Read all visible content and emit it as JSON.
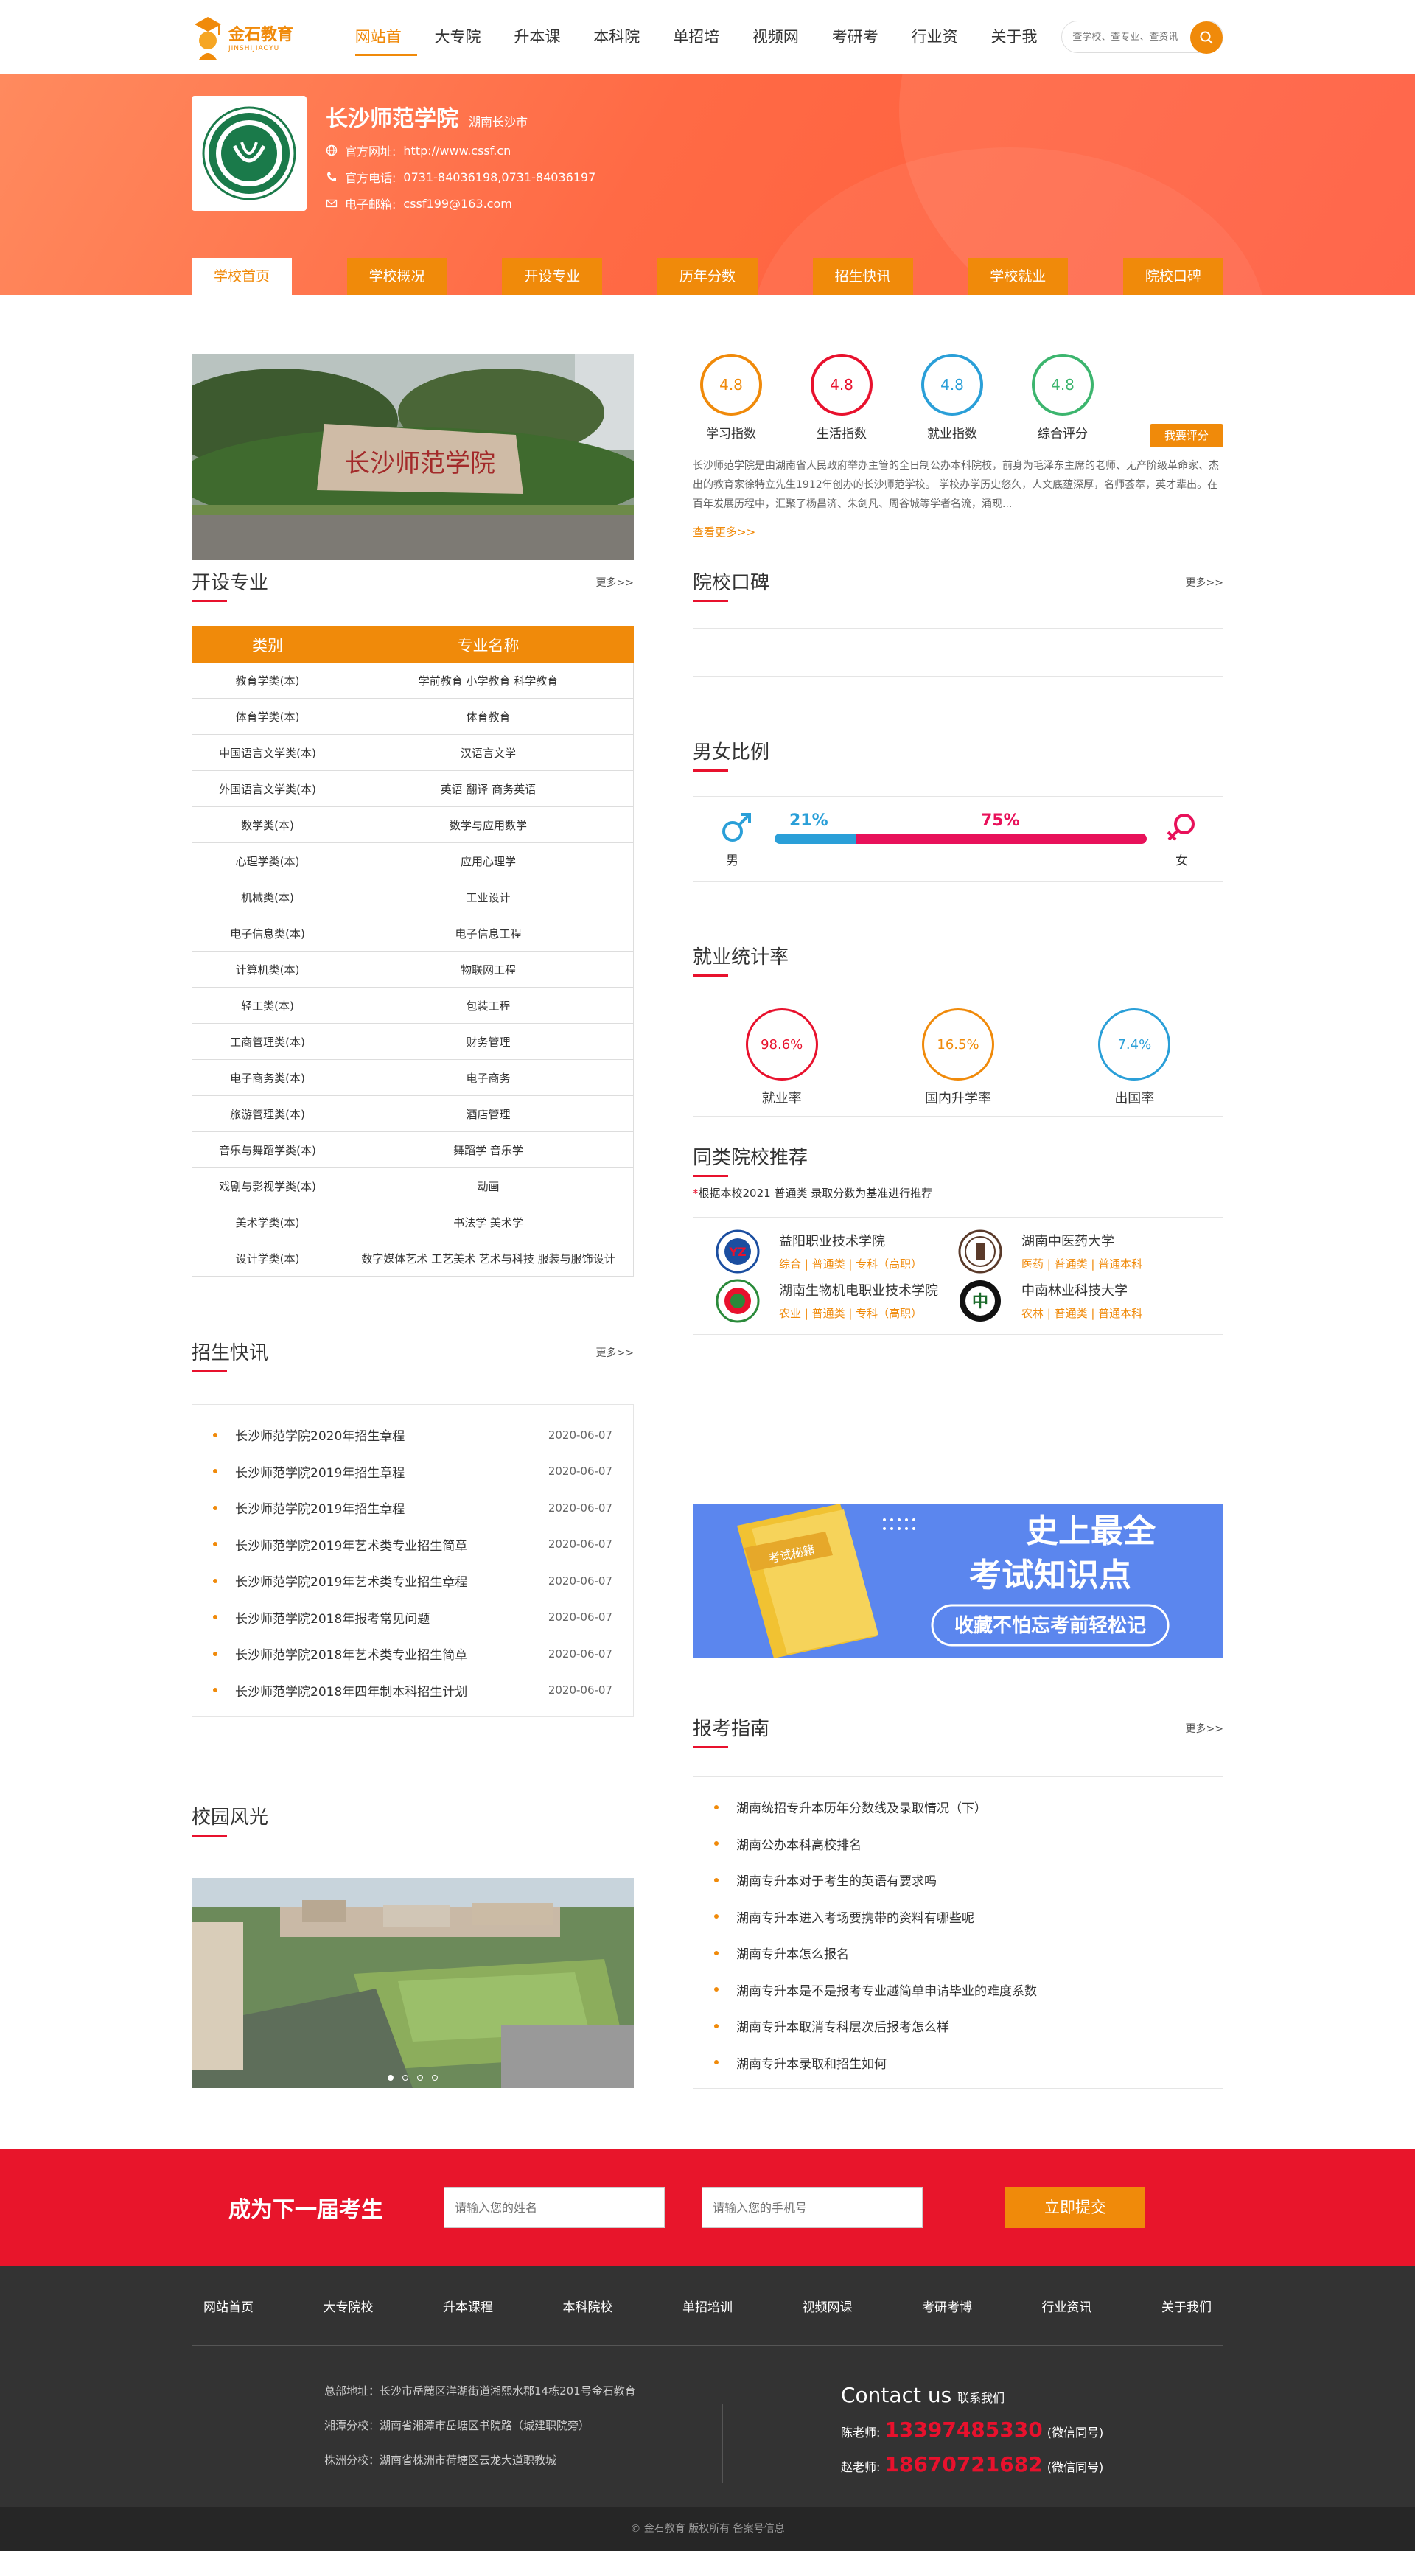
{
  "header": {
    "logo_cn": "金石教育",
    "logo_en": "JINSHIJIAOYU",
    "nav": [
      "网站首页",
      "大专院校",
      "升本课程",
      "本科院校",
      "单招培训",
      "视频网课",
      "考研考博",
      "行业资讯",
      "关于我们"
    ],
    "search_placeholder": "查学校、查专业、查资讯"
  },
  "school": {
    "name": "长沙师范学院",
    "location": "湖南长沙市",
    "website_label": "官方网址:",
    "website": "http://www.cssf.cn",
    "phone_label": "官方电话:",
    "phone": "0731-84036198,0731-84036197",
    "email_label": "电子邮箱:",
    "email": "cssf199@163.com"
  },
  "tabs": [
    "学校首页",
    "学校概况",
    "开设专业",
    "历年分数",
    "招生快讯",
    "学校就业",
    "院校口碑"
  ],
  "photo_sign": "长沙师范学院",
  "scores": [
    {
      "value": "4.8",
      "label": "学习指数",
      "color": "#f08a0a"
    },
    {
      "value": "4.8",
      "label": "生活指数",
      "color": "#e8112d"
    },
    {
      "value": "4.8",
      "label": "就业指数",
      "color": "#2a9fd8"
    },
    {
      "value": "4.8",
      "label": "综合评分",
      "color": "#3cb56e"
    }
  ],
  "rate_button": "我要评分",
  "intro": "长沙师范学院是由湖南省人民政府举办主管的全日制公办本科院校，前身为毛泽东主席的老师、无产阶级革命家、杰出的教育家徐特立先生1912年创办的长沙师范学校。        学校办学历史悠久，人文底蕴深厚，名师荟萃，英才辈出。在百年发展历程中，汇聚了杨昌济、朱剑凡、周谷城等学者名流，涌现...",
  "view_more": "查看更多>>",
  "more": "更多>>",
  "sections": {
    "majors": "开设专业",
    "reviews": "院校口碑",
    "gender": "男女比例",
    "employment": "就业统计率",
    "news": "招生快讯",
    "similar": "同类院校推荐",
    "campus": "校园风光",
    "guide": "报考指南"
  },
  "majors_table": {
    "headers": [
      "类别",
      "专业名称"
    ],
    "rows": [
      [
        "教育学类(本)",
        "学前教育  小学教育  科学教育"
      ],
      [
        "体育学类(本)",
        "体育教育"
      ],
      [
        "中国语言文学类(本)",
        "汉语言文学"
      ],
      [
        "外国语言文学类(本)",
        "英语  翻译  商务英语"
      ],
      [
        "数学类(本)",
        "数学与应用数学"
      ],
      [
        "心理学类(本)",
        "应用心理学"
      ],
      [
        "机械类(本)",
        "工业设计"
      ],
      [
        "电子信息类(本)",
        "电子信息工程"
      ],
      [
        "计算机类(本)",
        "物联网工程"
      ],
      [
        "轻工类(本)",
        "包装工程"
      ],
      [
        "工商管理类(本)",
        "财务管理"
      ],
      [
        "电子商务类(本)",
        "电子商务"
      ],
      [
        "旅游管理类(本)",
        "酒店管理"
      ],
      [
        "音乐与舞蹈学类(本)",
        "舞蹈学  音乐学"
      ],
      [
        "戏剧与影视学类(本)",
        "动画"
      ],
      [
        "美术学类(本)",
        "书法学  美术学"
      ],
      [
        "设计学类(本)",
        "数字媒体艺术  工艺美术  艺术与科技  服装与服饰设计"
      ]
    ]
  },
  "gender": {
    "male_pct": "21%",
    "female_pct": "75%",
    "male": 21,
    "female": 75,
    "male_label": "男",
    "female_label": "女"
  },
  "employment": [
    {
      "value": "98.6%",
      "label": "就业率",
      "color": "#e8112d"
    },
    {
      "value": "16.5%",
      "label": "国内升学率",
      "color": "#f08a0a"
    },
    {
      "value": "7.4%",
      "label": "出国率",
      "color": "#2a9fd8"
    }
  ],
  "rec_note": "根据本校2021 普通类 录取分数为基准进行推荐",
  "recommend": [
    {
      "name": "益阳职业技术学院",
      "tags": "综合 | 普通类 | 专科（高职）"
    },
    {
      "name": "湖南中医药大学",
      "tags": "医药 | 普通类 | 普通本科"
    },
    {
      "name": "湖南生物机电职业技术学院",
      "tags": "农业 | 普通类 | 专科（高职）"
    },
    {
      "name": "中南林业科技大学",
      "tags": "农林 | 普通类 | 普通本科"
    }
  ],
  "ad": {
    "book": "考试秘籍",
    "line1": "史上最全",
    "line2": "考试知识点",
    "line3": "收藏不怕忘考前轻松记"
  },
  "news": [
    {
      "title": "长沙师范学院2020年招生章程",
      "date": "2020-06-07"
    },
    {
      "title": "长沙师范学院2019年招生章程",
      "date": "2020-06-07"
    },
    {
      "title": "长沙师范学院2019年招生章程",
      "date": "2020-06-07"
    },
    {
      "title": "长沙师范学院2019年艺术类专业招生简章",
      "date": "2020-06-07"
    },
    {
      "title": "长沙师范学院2019年艺术类专业招生章程",
      "date": "2020-06-07"
    },
    {
      "title": "长沙师范学院2018年报考常见问题",
      "date": "2020-06-07"
    },
    {
      "title": "长沙师范学院2018年艺术类专业招生简章",
      "date": "2020-06-07"
    },
    {
      "title": "长沙师范学院2018年四年制本科招生计划",
      "date": "2020-06-07"
    }
  ],
  "guide": [
    "湖南统招专升本历年分数线及录取情况（下）",
    "湖南公办本科高校排名",
    "湖南专升本对于考生的英语有要求吗",
    "湖南专升本进入考场要携带的资料有哪些呢",
    "湖南专升本怎么报名",
    "湖南专升本是不是报考专业越简单申请毕业的难度系数",
    "湖南专升本取消专科层次后报考怎么样",
    "湖南专升本录取和招生如何"
  ],
  "signup": {
    "title": "成为下一届考生",
    "name_placeholder": "请输入您的姓名",
    "phone_placeholder": "请输入您的手机号",
    "submit": "立即提交"
  },
  "footer": {
    "nav": [
      "网站首页",
      "大专院校",
      "升本课程",
      "本科院校",
      "单招培训",
      "视频网课",
      "考研考博",
      "行业资讯",
      "关于我们"
    ],
    "addr1": "总部地址：长沙市岳麓区洋湖街道湘熙水郡14栋201号金石教育",
    "addr2": "湘潭分校：湖南省湘潭市岳塘区书院路（城建职院旁）",
    "addr3": "株洲分校：湖南省株洲市荷塘区云龙大道职教城",
    "contact_title": "Contact us",
    "contact_sub": "联系我们",
    "t1_label": "陈老师:",
    "t1_num": "13397485330",
    "t1_note": "(微信同号)",
    "t2_label": "赵老师:",
    "t2_num": "18670721682",
    "t2_note": "(微信同号)",
    "copyright": "© 金石教育 版权所有 备案号信息"
  },
  "colors": {
    "accent": "#f08a0a",
    "red": "#e8112d",
    "blue": "#2a9fd8",
    "green": "#3cb56e",
    "banner": "#ff6a45",
    "footer": "#333333"
  }
}
